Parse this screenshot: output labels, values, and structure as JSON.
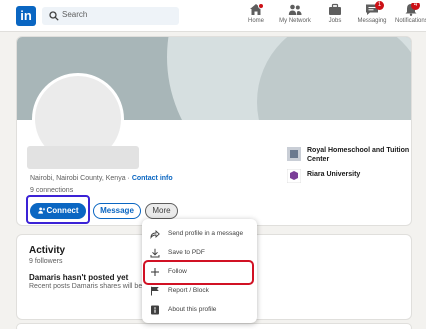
{
  "nav": {
    "logo_text": "in",
    "search_placeholder": "Search",
    "items": [
      {
        "label": "Home",
        "icon": "home-icon",
        "badge": ""
      },
      {
        "label": "My Network",
        "icon": "my-network-icon",
        "badge": ""
      },
      {
        "label": "Jobs",
        "icon": "jobs-icon",
        "badge": ""
      },
      {
        "label": "Messaging",
        "icon": "messaging-icon",
        "badge": "1"
      },
      {
        "label": "Notifications",
        "icon": "notifications-icon",
        "badge": "4"
      }
    ]
  },
  "profile": {
    "location": "Nairobi, Nairobi County, Kenya",
    "separator": " · ",
    "contact_info": "Contact info",
    "connections": "9 connections",
    "connect_label": "Connect",
    "message_label": "Message",
    "more_label": "More",
    "education": [
      {
        "name": "Royal Homeschool and Tuition Center",
        "logo": "school-logo"
      },
      {
        "name": "Riara University",
        "logo": "university-logo"
      }
    ]
  },
  "activity": {
    "title": "Activity",
    "followers": "9 followers",
    "headline": "Damaris hasn't posted yet",
    "subtext": "Recent posts Damaris shares will be"
  },
  "more_menu": {
    "items": [
      {
        "label": "Send profile in a message",
        "icon": "share-arrow-icon"
      },
      {
        "label": "Save to PDF",
        "icon": "download-icon"
      },
      {
        "label": "Follow",
        "icon": "plus-icon"
      },
      {
        "label": "Report / Block",
        "icon": "flag-icon"
      },
      {
        "label": "About this profile",
        "icon": "info-icon"
      }
    ]
  },
  "colors": {
    "brand": "#0a66c2",
    "highlight_connect": "#3b22d6",
    "highlight_follow": "#d11124",
    "badge": "#cc1016"
  }
}
